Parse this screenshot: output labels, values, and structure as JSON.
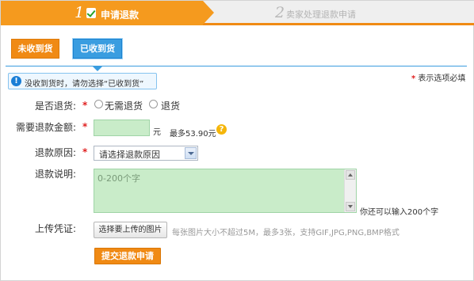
{
  "steps": [
    {
      "number": "1",
      "label": "申请退款",
      "active": true
    },
    {
      "number": "2",
      "label": "卖家处理退款申请",
      "active": false
    }
  ],
  "tabs": {
    "not_received": "未收到货",
    "received": "已收到货"
  },
  "notice": {
    "icon": "info-icon",
    "text": "没收到货时，请勿选择“已收到货”"
  },
  "required_note": {
    "star": "*",
    "text": "表示选项必填"
  },
  "form": {
    "return_goods": {
      "label": "是否退货:",
      "required": "*",
      "options": [
        "无需退货",
        "退货"
      ]
    },
    "refund_amount": {
      "label": "需要退款金额:",
      "required": "*",
      "value": "",
      "unit": "元",
      "max_text": "最多53.90元",
      "help_icon": "help-icon"
    },
    "refund_reason": {
      "label": "退款原因:",
      "required": "*",
      "selected": "请选择退款原因"
    },
    "refund_description": {
      "label": "退款说明:",
      "placeholder": "0-200个字",
      "remaining_text": "你还可以输入200个字"
    },
    "upload": {
      "label": "上传凭证:",
      "button": "选择要上传的图片",
      "tip": "每张图片大小不超过5M，最多3张，支持GIF,JPG,PNG,BMP格式"
    },
    "submit": "提交退款申请"
  }
}
